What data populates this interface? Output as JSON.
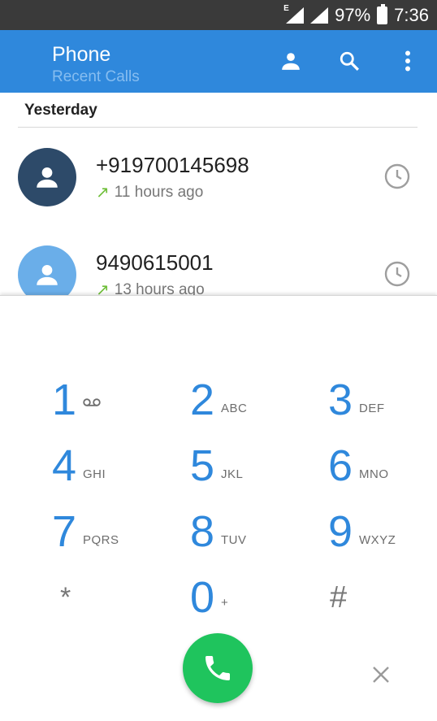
{
  "status": {
    "battery_text": "97%",
    "time": "7:36",
    "network_type": "E"
  },
  "app_bar": {
    "title": "Phone",
    "subtitle": "Recent Calls",
    "icons": [
      "contacts-icon",
      "search-icon",
      "overflow-menu-icon"
    ]
  },
  "recents": {
    "section": "Yesterday",
    "calls": [
      {
        "number": "+919700145698",
        "time": "11 hours ago",
        "avatar_color": "#2d4a69",
        "direction": "outgoing"
      },
      {
        "number": "9490615001",
        "time": "13 hours ago",
        "avatar_color": "#6aaee9",
        "direction": "outgoing"
      }
    ]
  },
  "dialpad": {
    "keys": [
      {
        "digit": "1",
        "letters": ""
      },
      {
        "digit": "2",
        "letters": "ABC"
      },
      {
        "digit": "3",
        "letters": "DEF"
      },
      {
        "digit": "4",
        "letters": "GHI"
      },
      {
        "digit": "5",
        "letters": "JKL"
      },
      {
        "digit": "6",
        "letters": "MNO"
      },
      {
        "digit": "7",
        "letters": "PQRS"
      },
      {
        "digit": "8",
        "letters": "TUV"
      },
      {
        "digit": "9",
        "letters": "WXYZ"
      },
      {
        "digit": "*",
        "letters": ""
      },
      {
        "digit": "0",
        "letters": "+"
      },
      {
        "digit": "#",
        "letters": ""
      }
    ]
  },
  "colors": {
    "accent": "#2f88dc",
    "call_button": "#1fc45d",
    "outgoing_arrow": "#6fbf3a"
  }
}
